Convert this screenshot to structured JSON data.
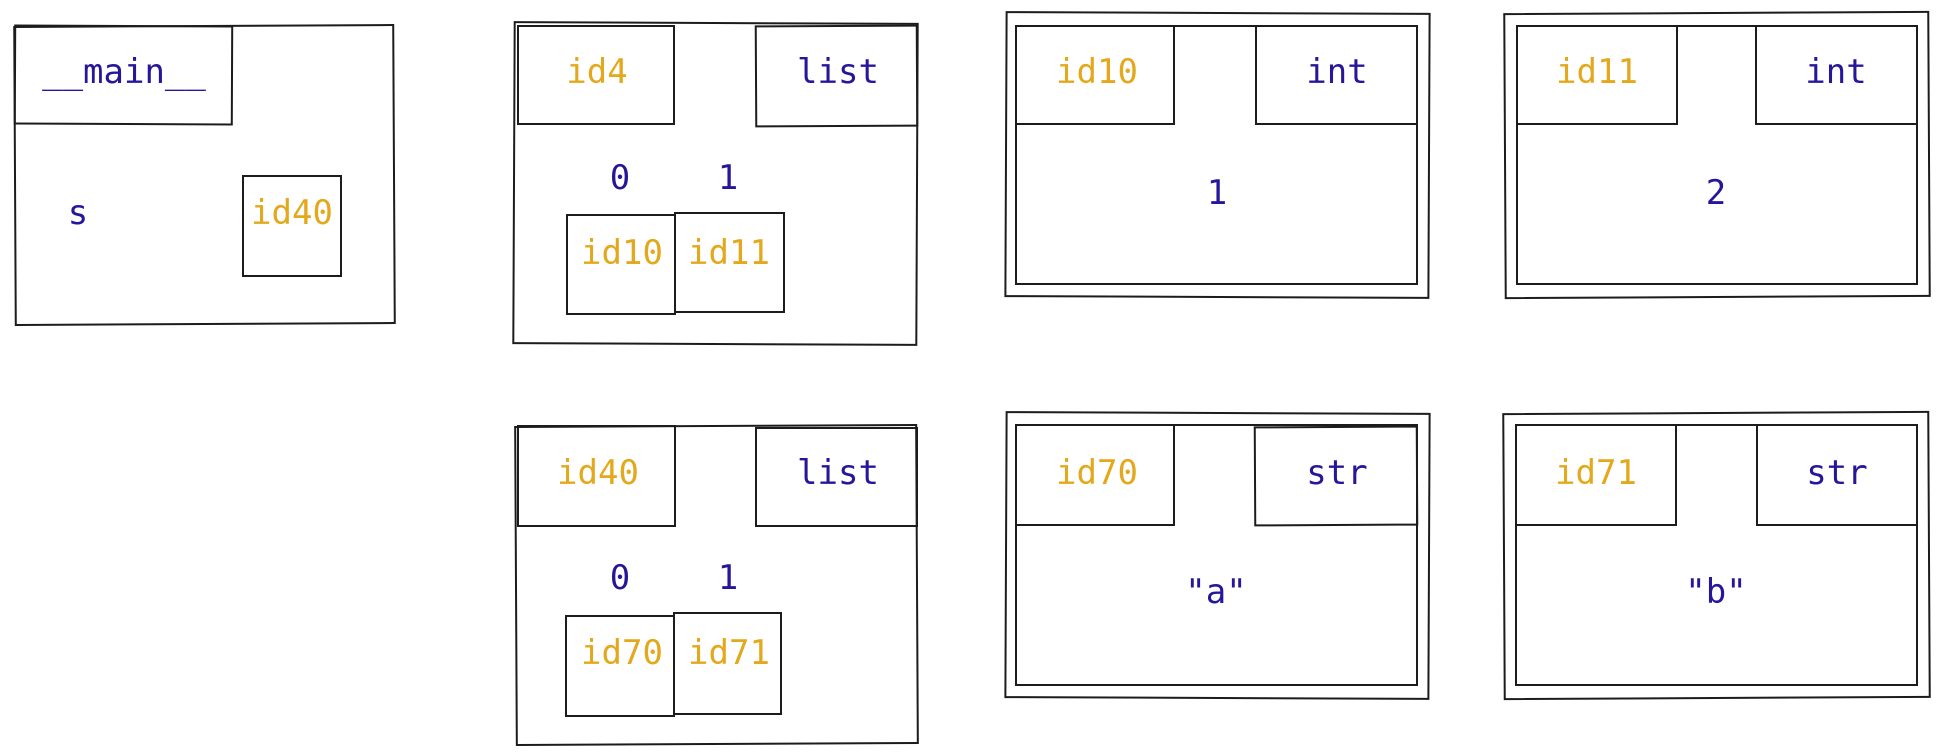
{
  "colors": {
    "id": "#e3a81c",
    "label": "#25169a",
    "stroke": "#1c1c1c",
    "background": "#ffffff"
  },
  "frame": {
    "name": "__main__",
    "variables": [
      {
        "name": "s",
        "ref": "id40"
      }
    ]
  },
  "objects": [
    {
      "id": "id4",
      "type": "list",
      "indices": [
        "0",
        "1"
      ],
      "refs": [
        "id10",
        "id11"
      ]
    },
    {
      "id": "id10",
      "type": "int",
      "value": "1"
    },
    {
      "id": "id11",
      "type": "int",
      "value": "2"
    },
    {
      "id": "id40",
      "type": "list",
      "indices": [
        "0",
        "1"
      ],
      "refs": [
        "id70",
        "id71"
      ]
    },
    {
      "id": "id70",
      "type": "str",
      "value": "\"a\""
    },
    {
      "id": "id71",
      "type": "str",
      "value": "\"b\""
    }
  ]
}
